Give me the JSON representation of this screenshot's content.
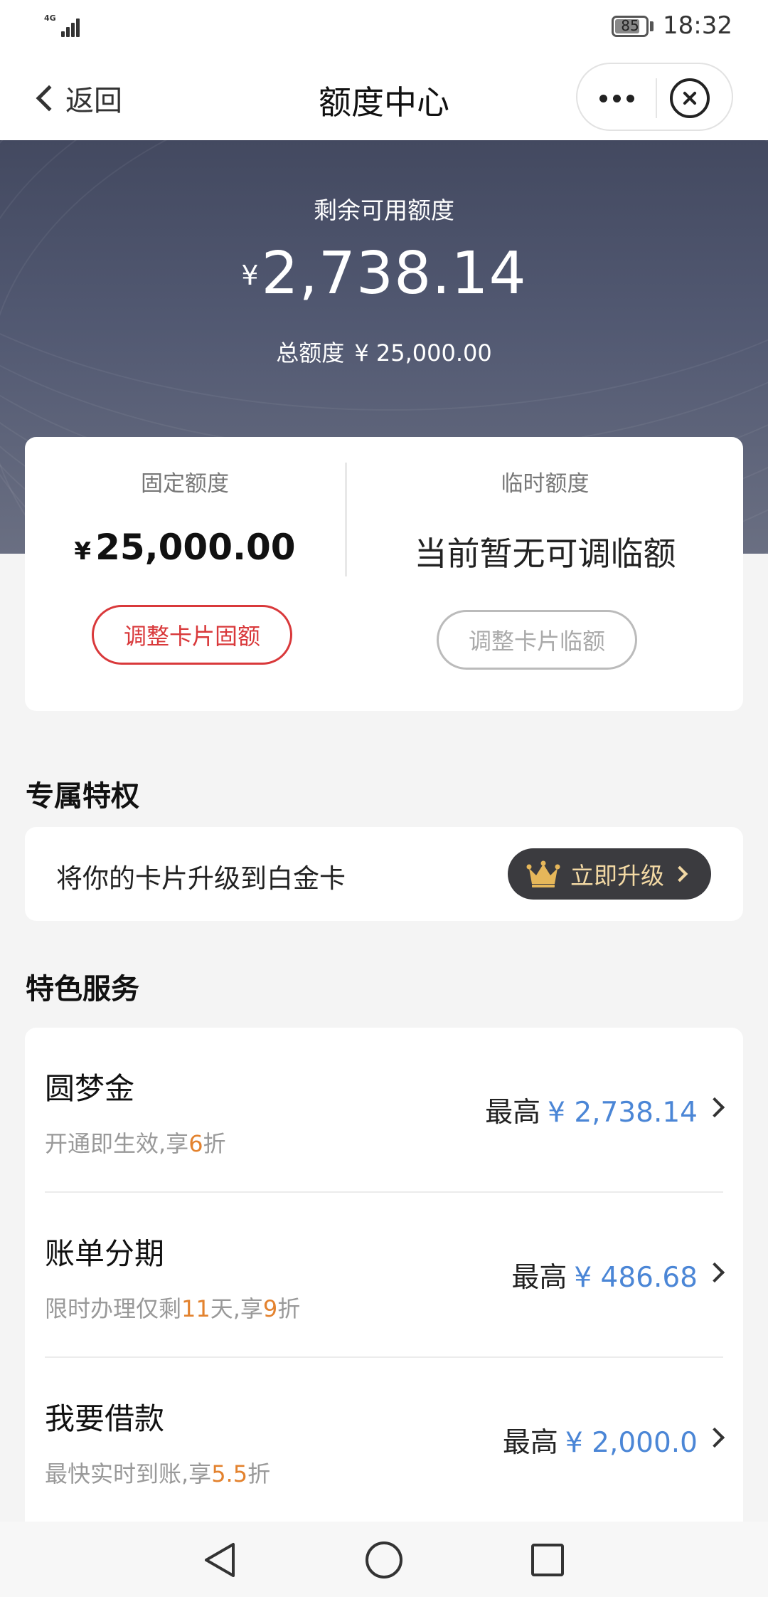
{
  "status_bar": {
    "network": "4G",
    "battery": "85",
    "battery_level": 0.85,
    "time": "18:32"
  },
  "nav": {
    "back_label": "返回",
    "title": "额度中心"
  },
  "hero": {
    "label": "剩余可用额度",
    "currency": "¥",
    "amount": "2,738.14",
    "total_label": "总额度",
    "total_value": "¥ 25,000.00"
  },
  "quota": {
    "fixed_label": "固定额度",
    "fixed_currency": "¥",
    "fixed_value": "25,000.00",
    "temp_label": "临时额度",
    "temp_value": "当前暂无可调临额",
    "adjust_fixed_button": "调整卡片固额",
    "adjust_temp_button": "调整卡片临额"
  },
  "privilege": {
    "title": "专属特权",
    "text": "将你的卡片升级到白金卡",
    "button": "立即升级"
  },
  "services": {
    "title": "特色服务",
    "items": [
      {
        "name": "圆梦金",
        "sub_pre": "开通即生效,享",
        "sub_hl1": "6",
        "sub_mid": "",
        "sub_hl2": "",
        "sub_post": "折",
        "prefix": "最高",
        "amount": "¥ 2,738.14"
      },
      {
        "name": "账单分期",
        "sub_pre": "限时办理仅剩",
        "sub_hl1": "11",
        "sub_mid": "天,享",
        "sub_hl2": "9",
        "sub_post": "折",
        "prefix": "最高",
        "amount": "¥ 486.68"
      },
      {
        "name": "我要借款",
        "sub_pre": "最快实时到账,享",
        "sub_hl1": "5.5",
        "sub_mid": "",
        "sub_hl2": "",
        "sub_post": "折",
        "prefix": "最高",
        "amount": "¥ 2,000.0"
      }
    ]
  },
  "icons": {
    "signal": "signal-icon",
    "battery": "battery-icon",
    "back": "chevron-left-icon",
    "more": "more-dots-icon",
    "close": "close-circle-icon",
    "crown": "crown-icon",
    "row_arrow": "chevron-right-icon",
    "sys_back": "triangle-back-icon",
    "sys_home": "circle-home-icon",
    "sys_recent": "square-recent-icon"
  },
  "colors": {
    "hero_bg": "#4b5168",
    "accent_red": "#d9393b",
    "amount_blue": "#4b86d6",
    "highlight_orange": "#e3822e",
    "upgrade_bg": "#3b3b3f",
    "upgrade_text": "#f3d9a4"
  }
}
